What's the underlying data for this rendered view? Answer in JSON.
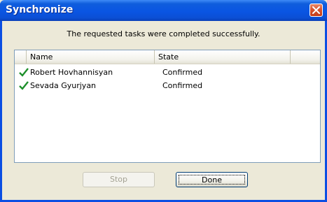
{
  "window": {
    "title": "Synchronize"
  },
  "message": "The requested tasks were completed successfully.",
  "list": {
    "columns": [
      "Name",
      "State"
    ],
    "rows": [
      {
        "status_icon": "checkmark-icon",
        "name": "Robert Hovhannisyan",
        "state": "Confirmed"
      },
      {
        "status_icon": "checkmark-icon",
        "name": "Sevada Gyurjyan",
        "state": "Confirmed"
      }
    ]
  },
  "buttons": {
    "stop_label": "Stop",
    "stop_enabled": false,
    "done_label": "Done"
  },
  "colors": {
    "titlebar": "#0a55e3",
    "check": "#1d8f2b",
    "close": "#d8542f"
  }
}
